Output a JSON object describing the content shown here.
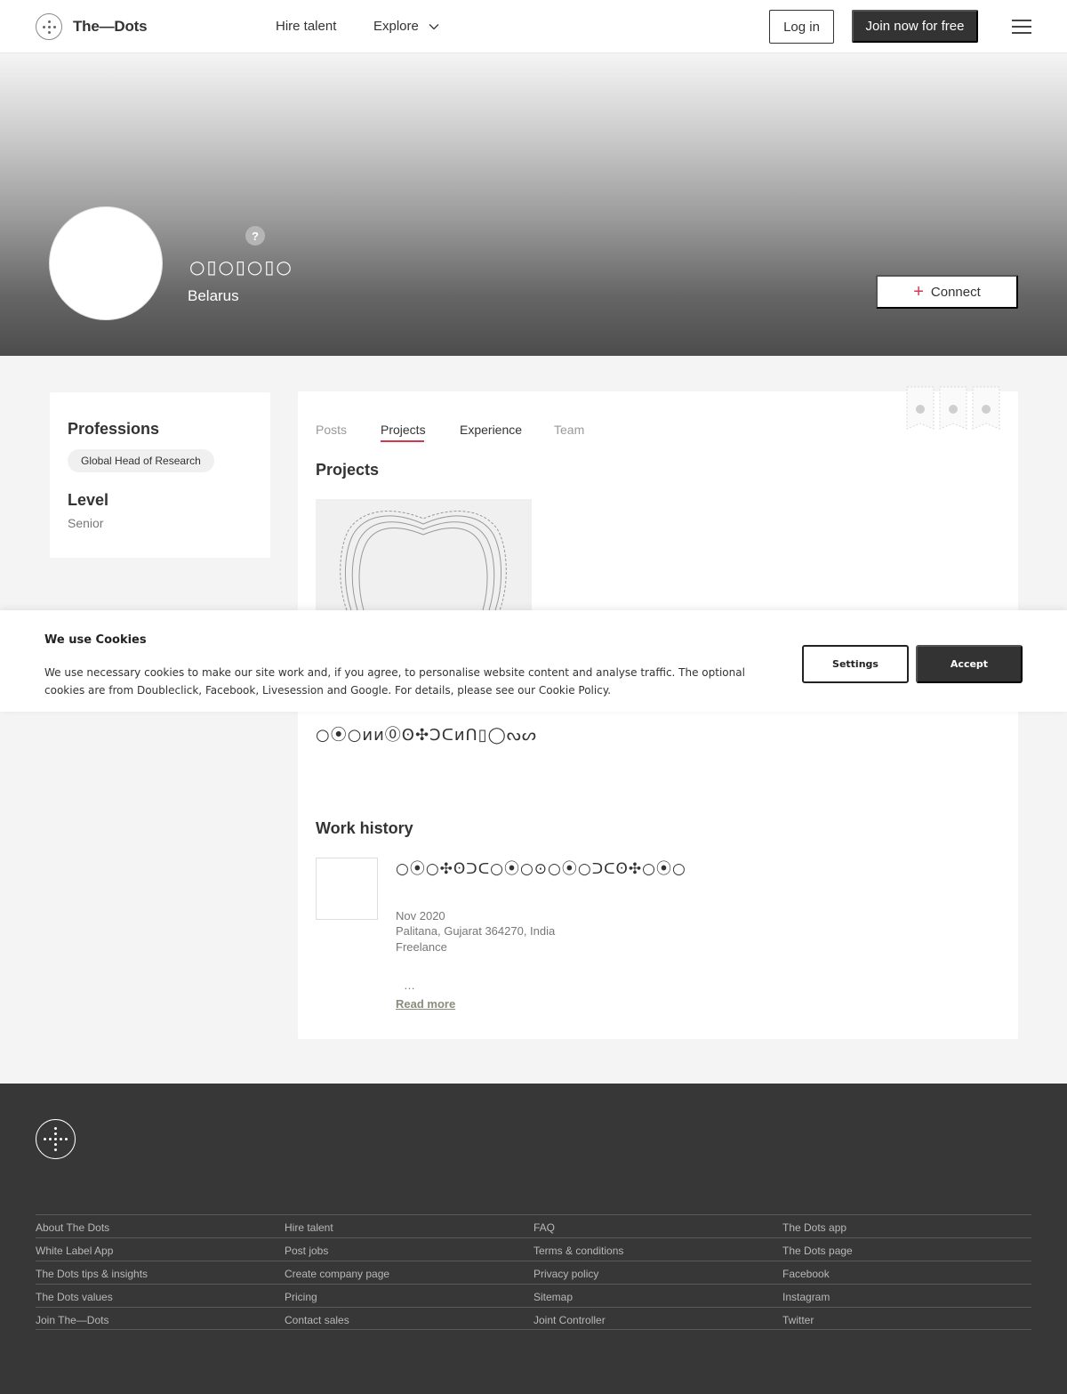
{
  "nav": {
    "brand": "The—Dots",
    "hire_talent": "Hire talent",
    "explore": "Explore",
    "login": "Log in",
    "join": "Join now for free"
  },
  "profile": {
    "help_badge": "?",
    "name": "○▯○▯○▯○",
    "location": "Belarus",
    "connect_label": "Connect"
  },
  "sidebar": {
    "professions_title": "Professions",
    "profession": "Global Head of Research",
    "level_title": "Level",
    "level": "Senior"
  },
  "tabs": [
    "Posts",
    "Projects",
    "Experience",
    "Team"
  ],
  "projects": {
    "title": "Projects",
    "project_name": "○⦿○ᴎᴎ⓪ʘ✣Ↄᑕᴎᑎ▯◯ᔓᔕ"
  },
  "work": {
    "title": "Work history",
    "job_title": "○⦿○✣ʘᑐᑕ○⦿○⊙○⦿○ᑐᑕʘ✣○⦿○",
    "date": "Nov 2020",
    "location": "Palitana, Gujarat 364270, India",
    "type": "Freelance",
    "ellipsis": "…",
    "read_more": "Read more"
  },
  "cookie": {
    "title": "We use Cookies",
    "text": "We use necessary cookies to make our site work and, if you agree, to personalise website content and analyse traffic. The optional cookies are from Doubleclick, Facebook, Livesession and Google. For details, please see our Cookie Policy.",
    "settings": "Settings",
    "accept": "Accept"
  },
  "footer": {
    "columns": [
      [
        "About The Dots",
        "White Label App",
        "The Dots tips & insights",
        "The Dots values",
        "Join The—Dots"
      ],
      [
        "Hire talent",
        "Post jobs",
        "Create company page",
        "Pricing",
        "Contact sales"
      ],
      [
        "FAQ",
        "Terms & conditions",
        "Privacy policy",
        "Sitemap",
        "Joint Controller"
      ],
      [
        "The Dots app",
        "The Dots page",
        "Facebook",
        "Instagram",
        "Twitter"
      ]
    ]
  },
  "colors": {
    "accent": "#d13a4e",
    "dark": "#333333",
    "footer_bg": "#373737"
  }
}
